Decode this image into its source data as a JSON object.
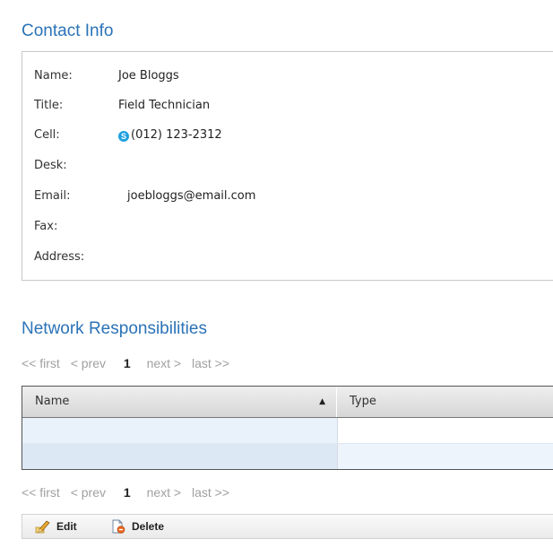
{
  "contact": {
    "title": "Contact Info",
    "fields": [
      {
        "label": "Name:",
        "value": "Joe Bloggs"
      },
      {
        "label": "Title:",
        "value": "Field Technician"
      },
      {
        "label": "Cell:",
        "value": "(012) 123-2312"
      },
      {
        "label": "Desk:",
        "value": ""
      },
      {
        "label": "Email:",
        "value": "joebloggs@email.com"
      },
      {
        "label": "Fax:",
        "value": ""
      },
      {
        "label": "Address:",
        "value": ""
      }
    ]
  },
  "network": {
    "title": "Network Responsibilities",
    "pager": {
      "first": "<< first",
      "prev": "< prev",
      "page": "1",
      "next": "next >",
      "last": "last >>"
    },
    "columns": [
      "Name",
      "Type"
    ],
    "sort_indicator": "▲",
    "rows": [
      [
        "",
        ""
      ],
      [
        "",
        ""
      ]
    ]
  },
  "toolbar": {
    "edit_label": "Edit",
    "delete_label": "Delete"
  },
  "icons": {
    "skype": "skype-icon",
    "edit": "pencil-icon",
    "delete": "delete-document-icon"
  },
  "colors": {
    "title_blue": "#2b73b7",
    "skype_blue": "#1fa0e0",
    "row_highlight": "#dde8f5"
  }
}
